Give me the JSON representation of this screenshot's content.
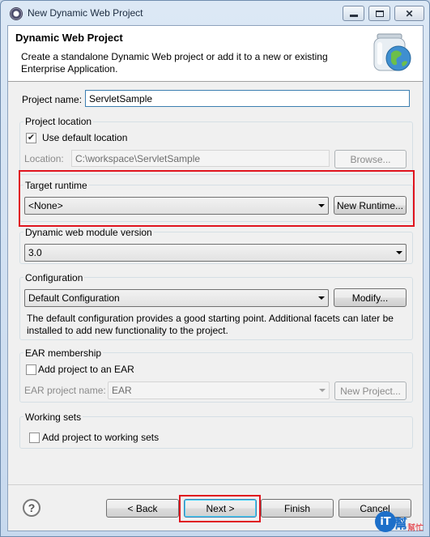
{
  "window": {
    "title": "New Dynamic Web Project",
    "controls": {
      "minimize": "▭",
      "maximize": "□",
      "close": "✕"
    }
  },
  "header": {
    "title": "Dynamic Web Project",
    "description": "Create a standalone Dynamic Web project or add it to a new or existing Enterprise Application.",
    "logo_icon": "web-project-globe-jar-icon"
  },
  "project_name": {
    "label": "Project name:",
    "value": "ServletSample"
  },
  "project_location": {
    "group_title": "Project location",
    "use_default_label": "Use default location",
    "use_default_checked": true,
    "location_label": "Location:",
    "location_value": "C:\\workspace\\ServletSample",
    "browse_label": "Browse..."
  },
  "target_runtime": {
    "group_title": "Target runtime",
    "selected": "<None>",
    "new_runtime_label": "New Runtime..."
  },
  "module_version": {
    "group_title": "Dynamic web module version",
    "selected": "3.0"
  },
  "configuration": {
    "group_title": "Configuration",
    "selected": "Default Configuration",
    "modify_label": "Modify...",
    "description": "The default configuration provides a good starting point. Additional facets can later be installed to add new functionality to the project."
  },
  "ear": {
    "group_title": "EAR membership",
    "add_label": "Add project to an EAR",
    "add_checked": false,
    "project_name_label": "EAR project name:",
    "project_name_value": "EAR",
    "new_project_label": "New Project..."
  },
  "working_sets": {
    "group_title": "Working sets",
    "add_label": "Add project to working sets",
    "add_checked": false
  },
  "footer": {
    "help_label": "?",
    "back_label": "< Back",
    "next_label": "Next >",
    "finish_label": "Finish",
    "cancel_label": "Cancel"
  },
  "watermark": {
    "brand": "iT",
    "sub": "幫",
    "sub2": "幫忙"
  },
  "colors": {
    "highlight": "#e0141e",
    "accent_button_border": "#3c7fb1"
  }
}
